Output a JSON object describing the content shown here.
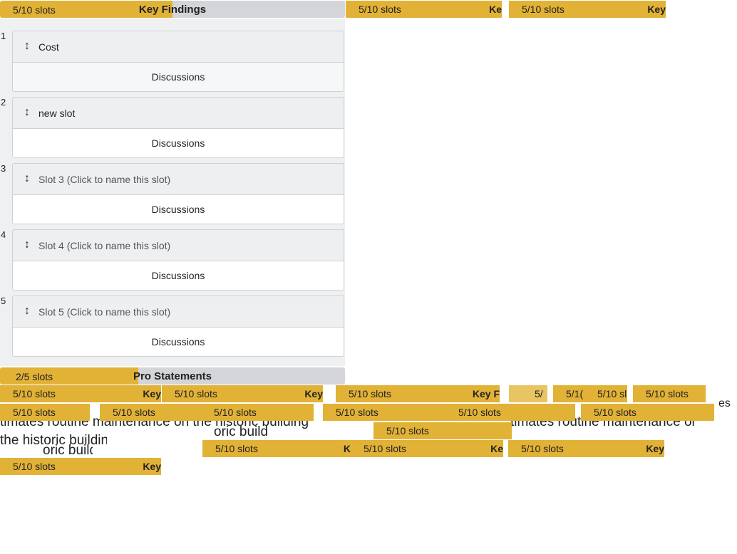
{
  "key_findings": {
    "count": "5/10 slots",
    "title": "Key Findings",
    "progress": 0.5
  },
  "slots": [
    {
      "number": "1",
      "name": "Cost",
      "is_placeholder": false,
      "discussions": "Discussions"
    },
    {
      "number": "2",
      "name": "new slot",
      "is_placeholder": false,
      "discussions": "Discussions"
    },
    {
      "number": "3",
      "name": "Slot 3 (Click to name this slot)",
      "is_placeholder": true,
      "discussions": "Discussions"
    },
    {
      "number": "4",
      "name": "Slot 4 (Click to name this slot)",
      "is_placeholder": true,
      "discussions": "Discussions"
    },
    {
      "number": "5",
      "name": "Slot 5 (Click to name this slot)",
      "is_placeholder": true,
      "discussions": "Discussions"
    }
  ],
  "pro_statements": {
    "count": "2/5 slots",
    "title": "Pro Statements",
    "progress": 0.4
  },
  "chip_count_label": "5/10 slots",
  "chip_count_partial": [
    "5/",
    "5/1(",
    "5/10 sl"
  ],
  "chip_title_fragments": [
    "Key",
    "Key F",
    "Ke",
    "K"
  ],
  "bleed_text": {
    "line_a": "timates routine maintenance on the historic building",
    "line_b": "the historic building",
    "line_c": "oric build",
    "edge": "es"
  },
  "drag_icon_glyph": "↕",
  "colors": {
    "accent": "#e2b236",
    "header_bg": "#d4d5d8",
    "slot_bg": "#eef0f2"
  }
}
